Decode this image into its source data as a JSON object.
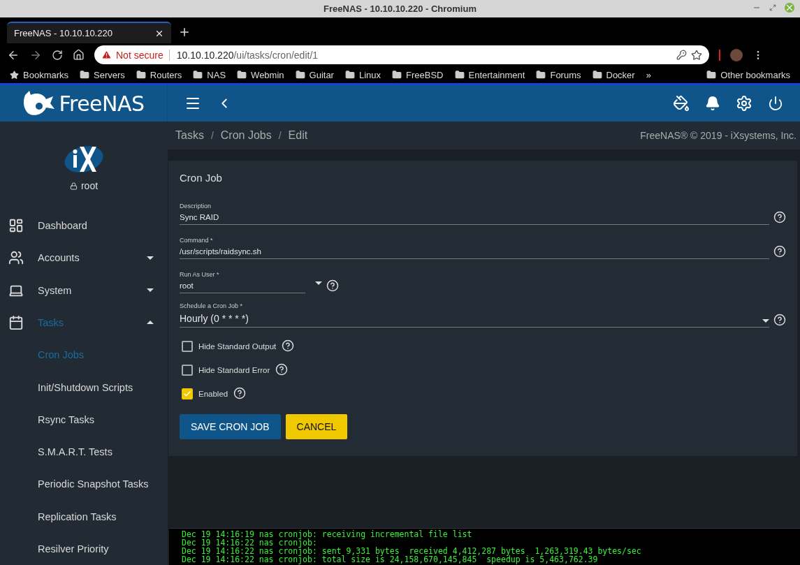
{
  "window": {
    "title": "FreeNAS - 10.10.10.220 - Chromium"
  },
  "browser": {
    "tab": {
      "title": "FreeNAS - 10.10.10.220"
    },
    "url": {
      "warning": "Not secure",
      "host": "10.10.10.220",
      "path": "/ui/tasks/cron/edit/1"
    },
    "bookmarks": [
      {
        "kind": "star",
        "label": "Bookmarks"
      },
      {
        "kind": "folder",
        "label": "Servers"
      },
      {
        "kind": "folder",
        "label": "Routers"
      },
      {
        "kind": "folder",
        "label": "NAS"
      },
      {
        "kind": "folder",
        "label": "Webmin"
      },
      {
        "kind": "folder",
        "label": "Guitar"
      },
      {
        "kind": "folder",
        "label": "Linux"
      },
      {
        "kind": "folder",
        "label": "FreeBSD"
      },
      {
        "kind": "folder",
        "label": "Entertainment"
      },
      {
        "kind": "folder",
        "label": "Forums"
      },
      {
        "kind": "folder",
        "label": "Docker"
      }
    ],
    "overflow": "»",
    "other_bookmarks": "Other bookmarks"
  },
  "app": {
    "logo": "FreeNAS",
    "user": "root",
    "breadcrumb": [
      "Tasks",
      "Cron Jobs",
      "Edit"
    ],
    "breadcrumb_separator": "/",
    "copyright": "FreeNAS® © 2019 - iXsystems, Inc.",
    "sidebar": [
      {
        "label": "Dashboard",
        "selected": false
      },
      {
        "label": "Accounts",
        "selected": false,
        "expanded": false
      },
      {
        "label": "System",
        "selected": false,
        "expanded": false
      },
      {
        "label": "Tasks",
        "selected": true,
        "expanded": true,
        "children": [
          {
            "label": "Cron Jobs",
            "selected": true
          },
          {
            "label": "Init/Shutdown Scripts",
            "selected": false
          },
          {
            "label": "Rsync Tasks",
            "selected": false
          },
          {
            "label": "S.M.A.R.T. Tests",
            "selected": false
          },
          {
            "label": "Periodic Snapshot Tasks",
            "selected": false
          },
          {
            "label": "Replication Tasks",
            "selected": false
          },
          {
            "label": "Resilver Priority",
            "selected": false
          }
        ]
      }
    ],
    "form": {
      "title": "Cron Job",
      "fields": [
        {
          "kind": "text",
          "label": "Description",
          "value": "Sync RAID"
        },
        {
          "kind": "text",
          "label": "Command *",
          "value": "/usr/scripts/raidsync.sh"
        },
        {
          "kind": "short-select",
          "label": "Run As User *",
          "value": "root"
        },
        {
          "kind": "select",
          "label": "Schedule a Cron Job *",
          "value": "Hourly (0 * * * *)"
        }
      ],
      "checkboxes": [
        {
          "label": "Hide Standard Output",
          "checked": false
        },
        {
          "label": "Hide Standard Error",
          "checked": false
        },
        {
          "label": "Enabled",
          "checked": true
        }
      ],
      "buttons": [
        {
          "kind": "primary",
          "label": "SAVE CRON JOB"
        },
        {
          "kind": "secondary",
          "label": "CANCEL"
        }
      ]
    }
  },
  "terminal": {
    "lines": [
      "Dec 19 14:16:19 nas cronjob: receiving incremental file list",
      "Dec 19 14:16:22 nas cronjob:",
      "Dec 19 14:16:22 nas cronjob: sent 9,331 bytes  received 4,412,287 bytes  1,263,319.43 bytes/sec",
      "Dec 19 14:16:22 nas cronjob: total size is 24,158,670,145,845  speedup is 5,463,762.39"
    ]
  }
}
